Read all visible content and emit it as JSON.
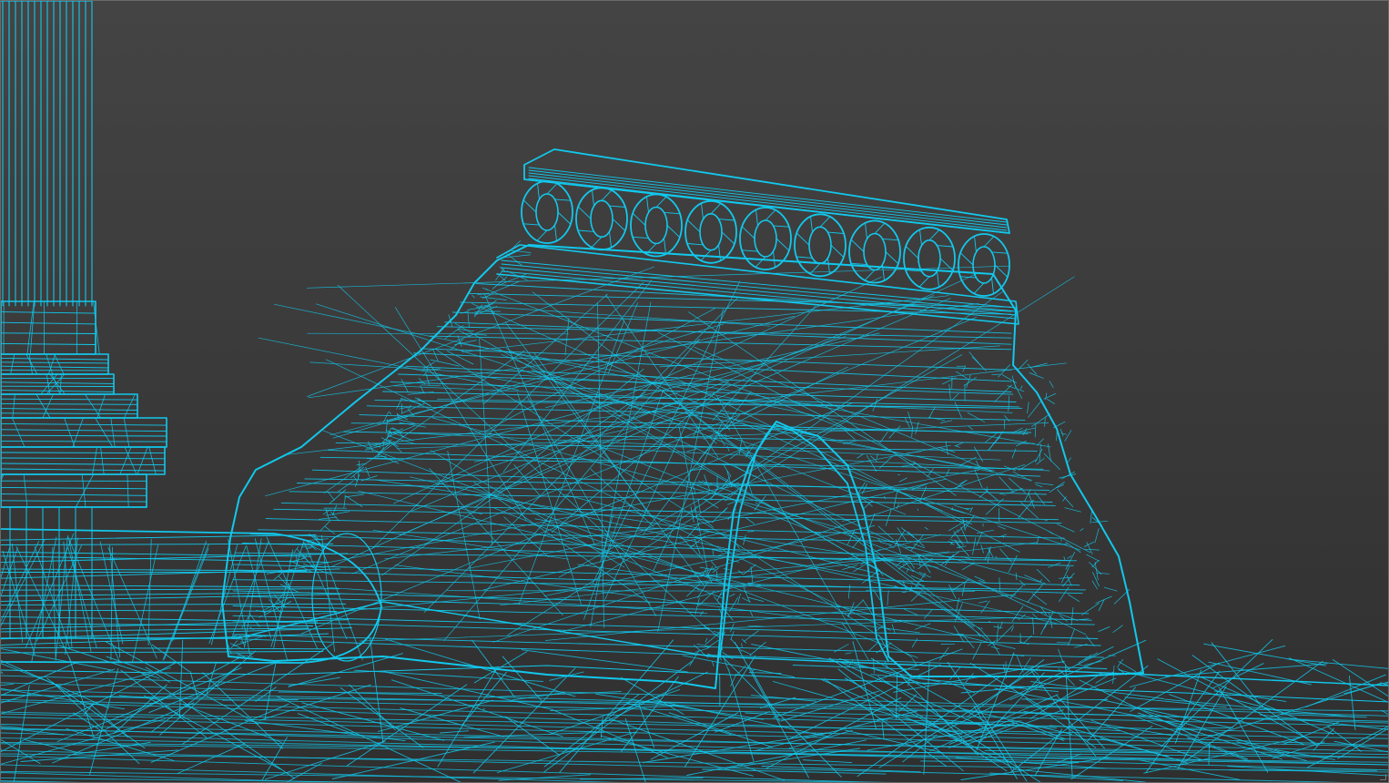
{
  "viewport": {
    "render_mode": "wireframe",
    "background_top": "#444444",
    "background_bottom": "#2f2f2f",
    "wire_color": "#12c8ec",
    "border_color": "#6a6a6a"
  },
  "scene": {
    "objects": [
      {
        "name": "column",
        "icon": "column-icon"
      },
      {
        "name": "rock-arch",
        "icon": "arch-icon"
      },
      {
        "name": "balustrade",
        "icon": "balustrade-icon"
      },
      {
        "name": "fallen-column",
        "icon": "cylinder-icon"
      },
      {
        "name": "ground-plane",
        "icon": "terrain-icon"
      }
    ]
  }
}
